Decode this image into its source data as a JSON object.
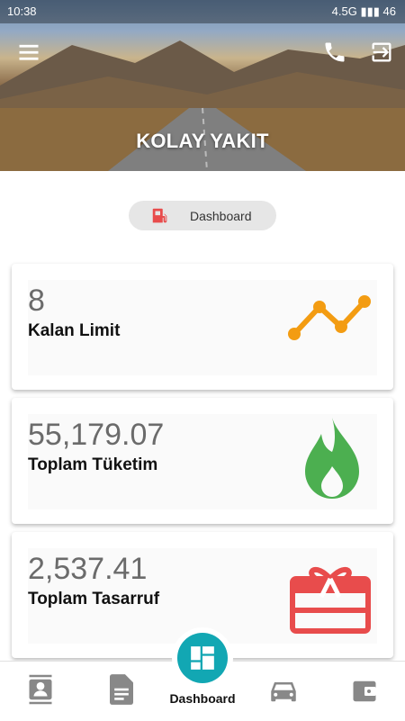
{
  "status_bar": {
    "time": "10:38",
    "network": "4.5G",
    "battery": "46"
  },
  "app": {
    "title": "KOLAY YAKIT"
  },
  "header_icons": {
    "menu": "menu-icon",
    "phone": "phone-icon",
    "logout": "exit-icon"
  },
  "section": {
    "label": "Dashboard",
    "icon": "fuel-pump-icon"
  },
  "cards": [
    {
      "value": "8",
      "label": "Kalan Limit",
      "icon": "trend-line-icon",
      "icon_color": "#f39c12"
    },
    {
      "value": "55,179.07",
      "label": "Toplam Tüketim",
      "icon": "flame-icon",
      "icon_color": "#4caf50"
    },
    {
      "value": "2,537.41",
      "label": "Toplam Tasarruf",
      "icon": "gift-card-icon",
      "icon_color": "#e84c4c"
    }
  ],
  "bottom_nav": {
    "center_label": "Dashboard",
    "items": [
      "contacts-icon",
      "document-icon",
      "dashboard-icon",
      "car-icon",
      "wallet-icon"
    ]
  },
  "colors": {
    "accent": "#12a7b3",
    "pill_bg": "#e6e6e6",
    "pump": "#e84c4c"
  }
}
